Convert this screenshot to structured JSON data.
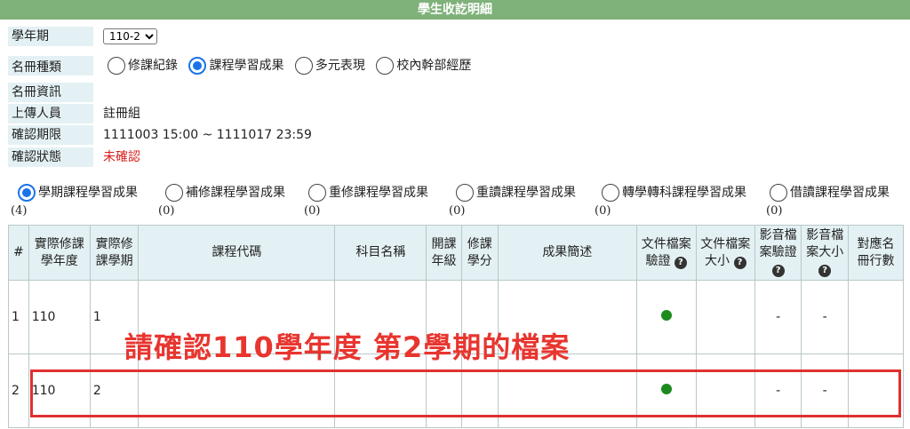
{
  "title": "學生收訖明細",
  "info": {
    "year_label": "學年期",
    "year_value": "110-2",
    "roster_type_label": "名冊種類",
    "roster_options": [
      "修課紀錄",
      "課程學習成果",
      "多元表現",
      "校內幹部經歷"
    ],
    "roster_selected": "課程學習成果",
    "roster_info_label": "名冊資訊",
    "uploader_label": "上傳人員",
    "uploader_value": "註冊組",
    "deadline_label": "確認期限",
    "deadline_value": "1111003 15:00 ~ 1111017 23:59",
    "status_label": "確認狀態",
    "status_value": "未確認"
  },
  "result_tabs": [
    {
      "label": "學期課程學習成果",
      "count": "(4)",
      "selected": true
    },
    {
      "label": "補修課程學習成果",
      "count": "(0)",
      "selected": false
    },
    {
      "label": "重修課程學習成果",
      "count": "(0)",
      "selected": false
    },
    {
      "label": "重讀課程學習成果",
      "count": "(0)",
      "selected": false
    },
    {
      "label": "轉學轉科課程學習成果",
      "count": "(0)",
      "selected": false
    },
    {
      "label": "借讀課程學習成果",
      "count": "(0)",
      "selected": false
    }
  ],
  "table": {
    "headers": {
      "num": "#",
      "year": "實際修課學年度",
      "term": "實際修課學期",
      "course_code": "課程代碼",
      "subject": "科目名稱",
      "grade": "開課年級",
      "credits": "修課學分",
      "summary": "成果簡述",
      "doc_verify": "文件檔案驗證",
      "doc_size": "文件檔案大小",
      "media_verify": "影音檔案驗證",
      "media_size": "影音檔案大小",
      "roster_lines": "對應名冊行數"
    },
    "rows": [
      {
        "num": "1",
        "year": "110",
        "term": "1",
        "media_verify": "-",
        "media_size": "-"
      },
      {
        "num": "2",
        "year": "110",
        "term": "2",
        "media_verify": "-",
        "media_size": "-"
      }
    ]
  },
  "annotation": "請確認110學年度 第2學期的檔案",
  "colors": {
    "header_bar": "#7fb17a",
    "label_bg": "#e4f1f4",
    "radio": "#1a73e8",
    "status": "#d71d1d",
    "annotation": "#e8352f",
    "verified_dot": "#1d8a1d"
  }
}
